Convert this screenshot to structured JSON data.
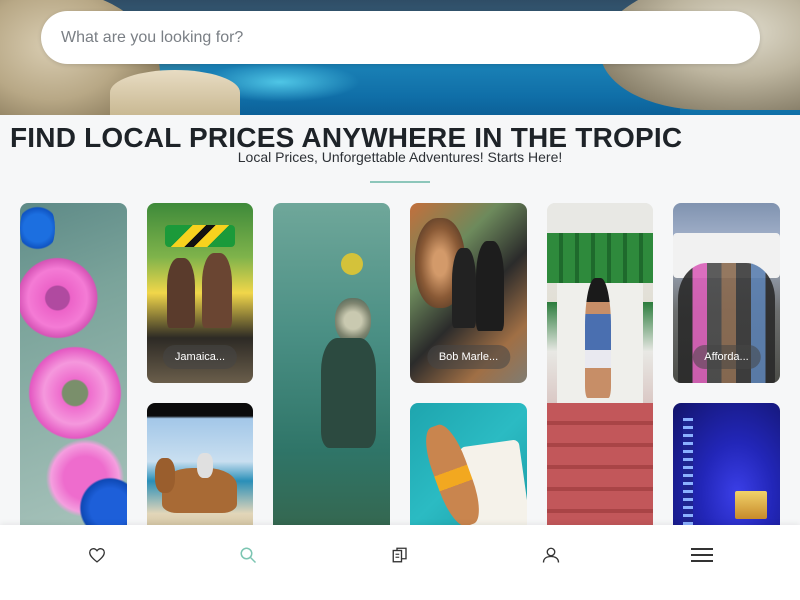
{
  "search": {
    "placeholder": "What are you looking for?"
  },
  "headline": "FIND LOCAL PRICES ANYWHERE IN THE TROPIC",
  "subheadline": "Local Prices, Unforgettable Adventures! Starts Here!",
  "cards": [
    {
      "label": ""
    },
    {
      "label": "Jamaica..."
    },
    {
      "label": ""
    },
    {
      "label": "Bob Marle..."
    },
    {
      "label": ""
    },
    {
      "label": "Afforda..."
    },
    {
      "label": ""
    },
    {
      "label": ""
    },
    {
      "label": ""
    }
  ],
  "bottom_nav": {
    "items": [
      {
        "icon": "heart-icon"
      },
      {
        "icon": "search-icon",
        "active": true
      },
      {
        "icon": "documents-icon"
      },
      {
        "icon": "user-icon"
      },
      {
        "icon": "menu-icon"
      }
    ],
    "active_color": "#7cc5b2",
    "icon_color": "#333333"
  },
  "accent_color": "#8cc6ba"
}
